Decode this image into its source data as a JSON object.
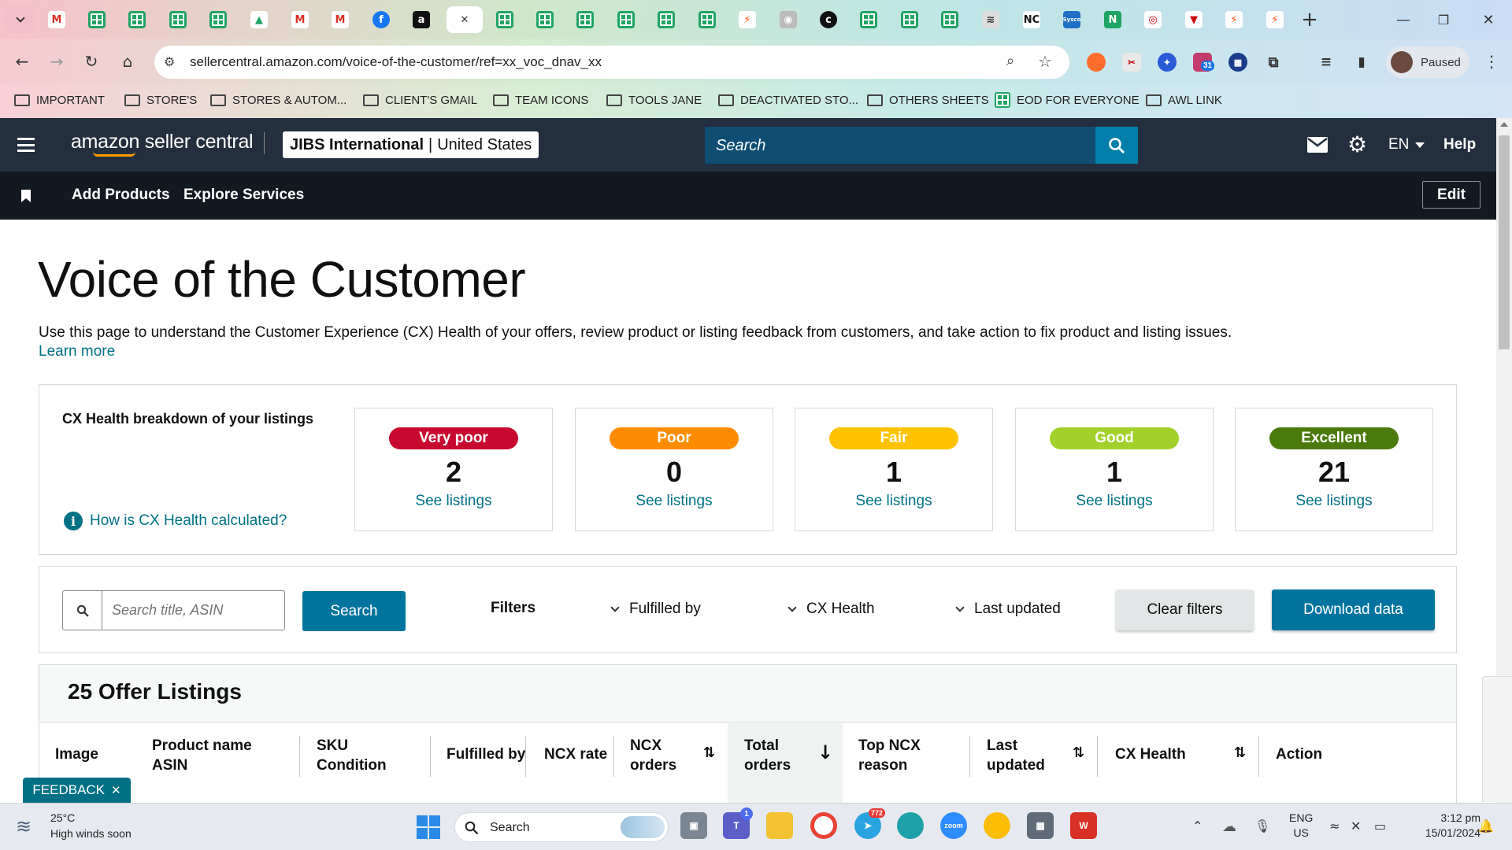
{
  "browser": {
    "url": "sellercentral.amazon.com/voice-of-the-customer/ref=xx_voc_dnav_xx",
    "profile_status": "Paused",
    "calendar_badge": "31",
    "bookmarks": [
      "IMPORTANT",
      "STORE'S",
      "STORES & AUTOM...",
      "CLIENT'S GMAIL",
      "TEAM ICONS",
      "TOOLS JANE",
      "DEACTIVATED STO...",
      "OTHERS SHEETS",
      "EOD FOR EVERYONE",
      "AWL LINK"
    ],
    "tab_icons": [
      "chevron-down-icon",
      "gmail-icon",
      "sheets-icon",
      "sheets-icon",
      "sheets-icon",
      "sheets-icon",
      "drive-icon",
      "gmail-icon",
      "gmail-icon",
      "facebook-icon",
      "amazon-icon",
      "close-icon",
      "sheets-icon",
      "sheets-icon",
      "sheets-icon",
      "sheets-icon",
      "sheets-icon",
      "sheets-icon",
      "zapier-icon",
      "globe-icon",
      "c-icon",
      "sheets-icon",
      "sheets-icon",
      "sheets-icon",
      "snowshoe-icon",
      "nc-icon",
      "sysco-icon",
      "n-icon",
      "circle-logo-icon",
      "v-icon",
      "zapier-icon",
      "zapier-icon",
      "new-tab-icon"
    ],
    "tab_text": {
      "amazon": "a",
      "facebook": "f",
      "c": "c",
      "nc": "NC",
      "sysco": "Sysco",
      "n": "N",
      "v": "V"
    }
  },
  "header": {
    "logo": "amazon seller central",
    "store": "JIBS International",
    "marketplace": "United States",
    "search_placeholder": "Search",
    "language": "EN",
    "help": "Help",
    "nav_links": [
      "Add Products",
      "Explore Services"
    ],
    "edit": "Edit"
  },
  "page": {
    "title": "Voice of the Customer",
    "description": "Use this page to understand the Customer Experience (CX) Health of your offers, review product or listing feedback from customers, and take action to fix product and listing issues.",
    "learn_more": "Learn more"
  },
  "cx_health": {
    "heading": "CX Health breakdown of your listings",
    "help_link": "How is CX Health calculated?",
    "categories": [
      {
        "label": "Very poor",
        "count": "2",
        "link": "See listings",
        "color": "#c7092f",
        "text_color": "#ffffff"
      },
      {
        "label": "Poor",
        "count": "0",
        "link": "See listings",
        "color": "#ff8c00",
        "text_color": "#ffffff"
      },
      {
        "label": "Fair",
        "count": "1",
        "link": "See listings",
        "color": "#ffc200",
        "text_color": "#ffffff"
      },
      {
        "label": "Good",
        "count": "1",
        "link": "See listings",
        "color": "#a2d12b",
        "text_color": "#ffffff"
      },
      {
        "label": "Excellent",
        "count": "21",
        "link": "See listings",
        "color": "#4a7a0c",
        "text_color": "#ffffff"
      }
    ]
  },
  "filters": {
    "search_placeholder": "Search title, ASIN",
    "search_button": "Search",
    "label": "Filters",
    "dropdowns": [
      "Fulfilled by",
      "CX Health",
      "Last updated"
    ],
    "clear": "Clear filters",
    "download": "Download data"
  },
  "table": {
    "title": "25 Offer Listings",
    "columns": [
      {
        "line1": "Image",
        "line2": ""
      },
      {
        "line1": "Product name",
        "line2": "ASIN"
      },
      {
        "line1": "SKU",
        "line2": "Condition"
      },
      {
        "line1": "Fulfilled by",
        "line2": ""
      },
      {
        "line1": "NCX rate",
        "line2": ""
      },
      {
        "line1": "NCX",
        "line2": "orders"
      },
      {
        "line1": "Total",
        "line2": "orders"
      },
      {
        "line1": "Top NCX",
        "line2": "reason"
      },
      {
        "line1": "Last",
        "line2": "updated"
      },
      {
        "line1": "CX Health",
        "line2": ""
      },
      {
        "line1": "Action",
        "line2": ""
      }
    ]
  },
  "feedback": "FEEDBACK",
  "taskbar": {
    "weather_temp": "25°C",
    "weather_text": "High winds soon",
    "search": "Search",
    "teams_badge": "1",
    "telegram_badge": "772",
    "lang1": "ENG",
    "lang2": "US",
    "time": "3:12 pm",
    "date": "15/01/2024"
  }
}
